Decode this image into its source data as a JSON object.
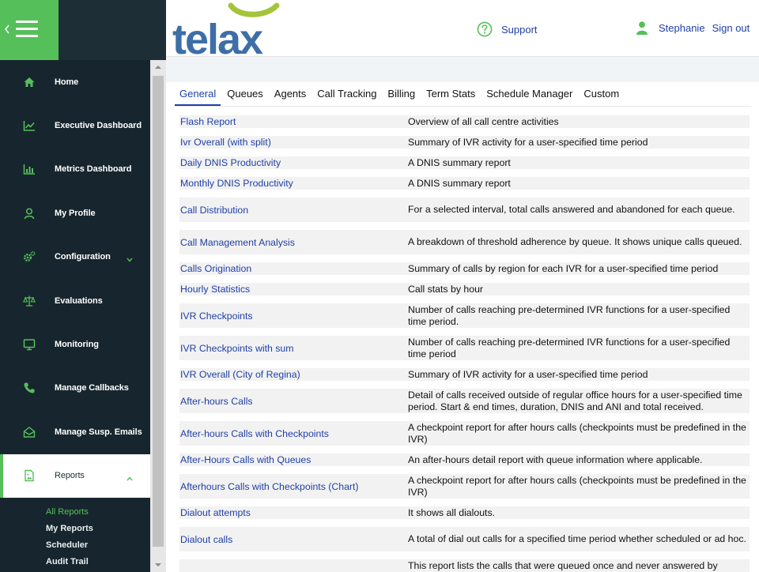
{
  "header": {
    "logo_text": "telax",
    "support_label": "Support",
    "user_name": "Stephanie",
    "sign_out_label": "Sign out"
  },
  "sidebar": {
    "items": [
      {
        "label": "Home",
        "icon": "home-icon"
      },
      {
        "label": "Executive Dashboard",
        "icon": "line-chart-icon"
      },
      {
        "label": "Metrics Dashboard",
        "icon": "bar-chart-icon"
      },
      {
        "label": "My Profile",
        "icon": "user-icon"
      },
      {
        "label": "Configuration",
        "icon": "gears-icon"
      },
      {
        "label": "Evaluations",
        "icon": "balance-scale-icon"
      },
      {
        "label": "Monitoring",
        "icon": "monitor-icon"
      },
      {
        "label": "Manage Callbacks",
        "icon": "phone-icon"
      },
      {
        "label": "Manage Susp. Emails",
        "icon": "envelope-open-icon"
      },
      {
        "label": "Reports",
        "icon": "file-image-icon"
      }
    ],
    "reports_submenu": [
      "All Reports",
      "My Reports",
      "Scheduler",
      "Audit Trail"
    ]
  },
  "tabs": [
    "General",
    "Queues",
    "Agents",
    "Call Tracking",
    "Billing",
    "Term Stats",
    "Schedule Manager",
    "Custom"
  ],
  "active_tab": "General",
  "reports": [
    {
      "name": "Flash Report",
      "desc": "Overview of all call centre activities"
    },
    {
      "name": "Ivr Overall (with split)",
      "desc": "Summary of IVR activity for a user-specified time period"
    },
    {
      "name": "Daily DNIS Productivity",
      "desc": "A DNIS summary report"
    },
    {
      "name": "Monthly DNIS Productivity",
      "desc": "A DNIS summary report"
    },
    {
      "name": "Call Distribution",
      "desc": "For a selected interval, total calls answered and abandoned for each queue."
    },
    {
      "name": "Call Management Analysis",
      "desc": "A breakdown of threshold adherence by queue. It shows unique calls queued."
    },
    {
      "name": "Calls Origination",
      "desc": "Summary of calls by region for each IVR for a user-specified time period"
    },
    {
      "name": "Hourly Statistics",
      "desc": "Call stats by hour"
    },
    {
      "name": "IVR Checkpoints",
      "desc": "Number of calls reaching pre-determined IVR functions for a user-specified time period."
    },
    {
      "name": "IVR Checkpoints with sum",
      "desc": "Number of calls reaching pre-determined IVR functions for a user-specified time period"
    },
    {
      "name": "IVR Overall (City of Regina)",
      "desc": "Summary of IVR activity for a user-specified time period"
    },
    {
      "name": "After-hours Calls",
      "desc": "Detail of calls received outside of regular office hours for a user-specified time period. Start & end times, duration, DNIS and ANI and total received."
    },
    {
      "name": "After-hours Calls with Checkpoints",
      "desc": "A checkpoint report for after hours calls (checkpoints must be predefined in the IVR)"
    },
    {
      "name": "After-Hours Calls with Queues",
      "desc": "An after-hours detail report with queue information where applicable."
    },
    {
      "name": "Afterhours Calls with Checkpoints (Chart)",
      "desc": "A checkpoint report for after hours calls (checkpoints must be predefined in the IVR)"
    },
    {
      "name": "Dialout attempts",
      "desc": "It shows all dialouts."
    },
    {
      "name": "Dialout calls",
      "desc": "A total of dial out calls for a specified time period whether scheduled or ad hoc."
    },
    {
      "name": "",
      "desc": "This report lists the calls that were queued once and never answered by"
    }
  ],
  "colors": {
    "accent_green": "#55c059",
    "sidebar_bg": "#17262e",
    "link_blue": "#1f3fa6",
    "logo_blue": "#3d6fa6",
    "logo_arc": "#a6c43b"
  }
}
